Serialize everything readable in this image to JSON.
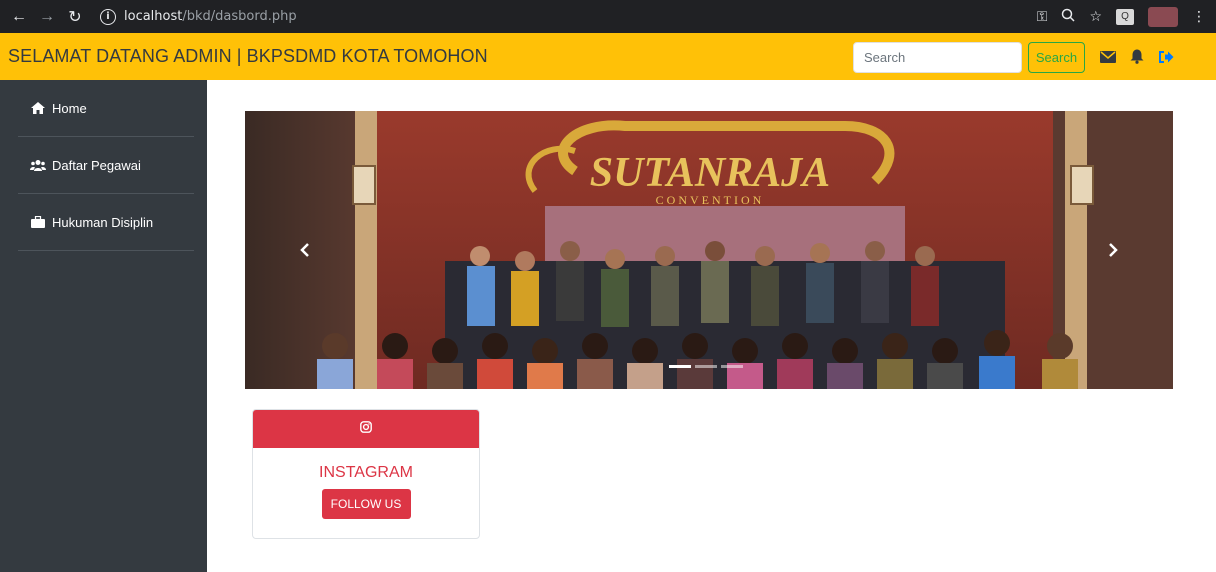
{
  "browser": {
    "url_host": "localhost",
    "url_path": "/bkd/dasbord.php"
  },
  "navbar": {
    "brand": "SELAMAT DATANG ADMIN | BKPSDMD KOTA TOMOHON",
    "search_placeholder": "Search",
    "search_button": "Search",
    "icons": [
      "envelope-icon",
      "bell-icon",
      "sign-out-icon"
    ],
    "accent_color": "#ffc107"
  },
  "sidebar": {
    "items": [
      {
        "label": "Home",
        "icon": "home-icon"
      },
      {
        "label": "Daftar Pegawai",
        "icon": "users-icon"
      },
      {
        "label": "Hukuman Disiplin",
        "icon": "briefcase-icon"
      }
    ]
  },
  "carousel": {
    "slides": 3,
    "active_slide": 1,
    "banner_text": "SUTANRAJA",
    "banner_subtext": "CONVENTION"
  },
  "instagram_card": {
    "icon": "instagram-icon",
    "title": "INSTAGRAM",
    "button": "FOLLOW US",
    "color": "#dc3545"
  }
}
